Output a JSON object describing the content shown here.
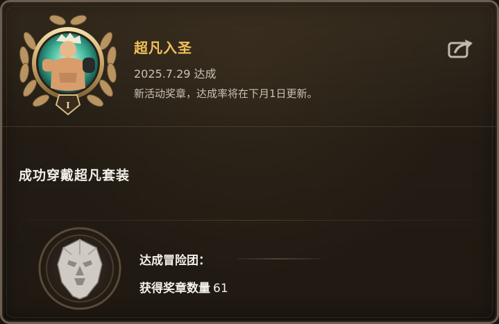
{
  "header": {
    "title": "超凡入圣",
    "date": "2025.7.29 达成",
    "notice": "新活动奖章，达成率将在下月1日更新。",
    "medal_rank": "I",
    "share_icon": "share-icon"
  },
  "condition": {
    "text": "成功穿戴超凡套装"
  },
  "footer": {
    "adventure_label": "达成冒险团：",
    "adventure_value": "",
    "count_label": "获得奖章数量",
    "count_value": "61",
    "badge_icon": "lion-head-icon"
  },
  "colors": {
    "title": "#f1c15a",
    "body_text": "#c9c2b7",
    "panel_border": "#6a5f52"
  }
}
